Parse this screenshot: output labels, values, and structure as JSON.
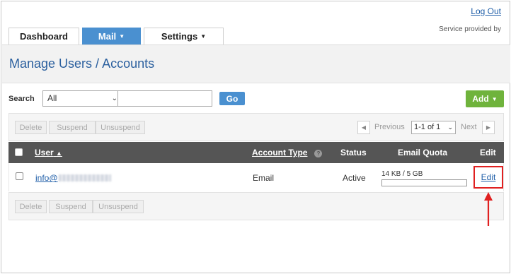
{
  "header": {
    "logout_label": "Log Out",
    "provided_by": "Service provided by"
  },
  "tabs": [
    {
      "label": "Dashboard"
    },
    {
      "label": "Mail"
    },
    {
      "label": "Settings"
    }
  ],
  "page": {
    "title": "Manage Users / Accounts"
  },
  "search": {
    "label": "Search",
    "filter_value": "All",
    "query_value": "",
    "go_label": "Go"
  },
  "actions": {
    "add_label": "Add"
  },
  "toolbar": {
    "delete_label": "Delete",
    "suspend_label": "Suspend",
    "unsuspend_label": "Unsuspend"
  },
  "pager": {
    "previous_label": "Previous",
    "range_value": "1-1 of 1",
    "next_label": "Next"
  },
  "table": {
    "columns": {
      "user": "User",
      "account_type": "Account Type",
      "status": "Status",
      "email_quota": "Email Quota",
      "edit": "Edit"
    },
    "rows": [
      {
        "user": "info@",
        "account_type": "Email",
        "status": "Active",
        "quota_text": "14 KB / 5 GB",
        "quota_fraction": 0.0,
        "edit_label": "Edit"
      }
    ]
  },
  "colors": {
    "accent_blue": "#4a90d0",
    "add_green": "#6fb33c",
    "header_gray": "#555555",
    "highlight_red": "#e02020",
    "title_blue": "#2a5f9e"
  }
}
